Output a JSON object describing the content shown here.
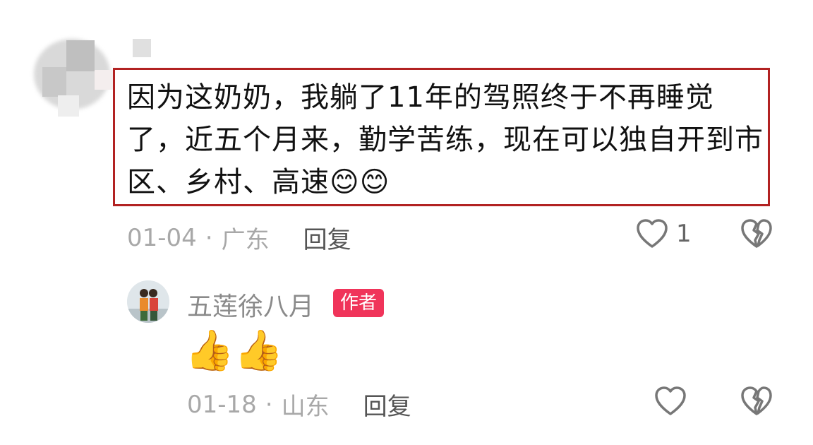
{
  "comments": [
    {
      "text": "因为这奶奶，我躺了11年的驾照终于不再睡觉了，近五个月来，勤学苦练，现在可以独自开到市区、乡村、高速😊😊",
      "date": "01-04",
      "location": "广东",
      "reply_label": "回复",
      "like_count": "1",
      "icons": {
        "like": "heart-outline-icon",
        "dislike": "broken-heart-icon"
      }
    },
    {
      "author": "五莲徐八月",
      "badge": "作者",
      "text": "👍👍",
      "date": "01-18",
      "location": "山东",
      "reply_label": "回复",
      "icons": {
        "like": "heart-outline-icon",
        "dislike": "broken-heart-icon"
      }
    }
  ],
  "colors": {
    "highlight_border": "#b22222",
    "badge_bg": "#f0345a",
    "meta_text": "#a8a8a8"
  },
  "separator": "·"
}
